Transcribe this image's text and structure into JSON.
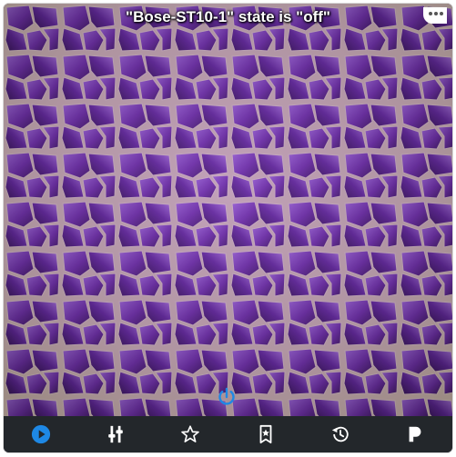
{
  "card": {
    "title": "\"Bose-ST10-1\" state is \"off\"",
    "more_icon": "corner-menu-icon"
  },
  "artwork": {
    "description_icon": "amethyst-crystals-image"
  },
  "power_button": {
    "icon": "power-icon",
    "color": "#1e88e5"
  },
  "toolbar": {
    "background": "#23272b",
    "buttons": [
      {
        "icon": "play-circle-icon",
        "color": "#1e88e5",
        "active": true
      },
      {
        "icon": "equalizer-icon",
        "color": "#ffffff"
      },
      {
        "icon": "star-icon",
        "color": "#ffffff"
      },
      {
        "icon": "bookmark-star-icon",
        "color": "#ffffff"
      },
      {
        "icon": "history-icon",
        "color": "#ffffff"
      },
      {
        "icon": "pandora-icon",
        "color": "#ffffff"
      }
    ]
  }
}
